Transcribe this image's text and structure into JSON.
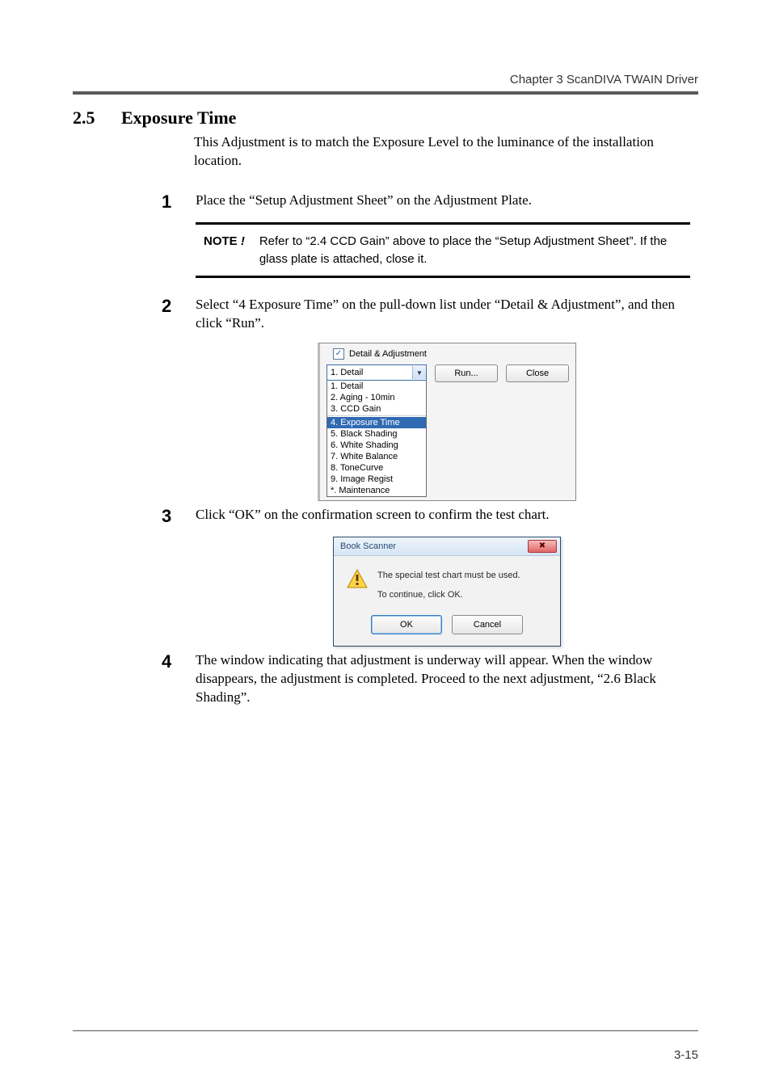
{
  "header": {
    "chapter": "Chapter 3  ScanDIVA TWAIN Driver"
  },
  "section": {
    "number": "2.5",
    "title": "Exposure Time",
    "intro": "This Adjustment is to match the Exposure Level to the luminance of the installation location."
  },
  "steps": {
    "s1": {
      "num": "1",
      "text": "Place the “Setup Adjustment Sheet” on the Adjustment Plate."
    },
    "s2": {
      "num": "2",
      "text": "Select “4 Exposure Time” on the pull-down list under “Detail & Adjustment”, and then click “Run”."
    },
    "s3": {
      "num": "3",
      "text": "Click “OK” on the confirmation screen to confirm the test chart."
    },
    "s4": {
      "num": "4",
      "text": "The window indicating that adjustment is underway will appear. When the window disappears, the adjustment is completed. Proceed to the next adjustment, “2.6 Black Shading”."
    }
  },
  "note": {
    "label": "NOTE",
    "bang": "!",
    "text": "Refer to “2.4 CCD Gain” above to place the “Setup Adjustment Sheet”. If the glass plate is attached, close it."
  },
  "fig1": {
    "checkbox_label": "Detail & Adjustment",
    "selected": "1. Detail",
    "options": [
      "1. Detail",
      "2. Aging - 10min",
      "3. CCD Gain",
      "4. Exposure Time",
      "5. Black Shading",
      "6. White Shading",
      "7. White Balance",
      "8. ToneCurve",
      "9. Image Regist",
      "*. Maintenance"
    ],
    "highlight_index": 3,
    "run": "Run...",
    "close": "Close"
  },
  "fig2": {
    "title": "Book Scanner",
    "close_glyph": "✖",
    "line1": "The special test chart must be used.",
    "line2": "To continue, click OK.",
    "ok": "OK",
    "cancel": "Cancel"
  },
  "footer": {
    "page": "3-15"
  }
}
